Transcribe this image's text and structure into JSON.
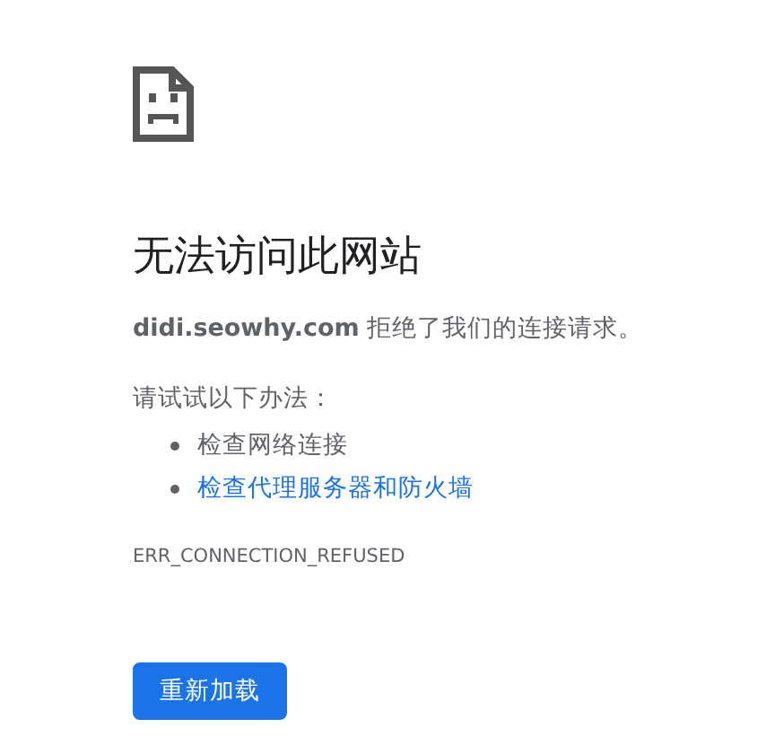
{
  "title": "无法访问此网站",
  "message": {
    "host": "didi.seowhy.com",
    "text": "拒绝了我们的连接请求。"
  },
  "suggestions_heading": "请试试以下办法：",
  "suggestions": [
    {
      "kind": "text",
      "label": "检查网络连接"
    },
    {
      "kind": "link",
      "label": "检查代理服务器和防火墙"
    }
  ],
  "error_code": "ERR_CONNECTION_REFUSED",
  "buttons": [
    {
      "label": "重新加载"
    }
  ]
}
